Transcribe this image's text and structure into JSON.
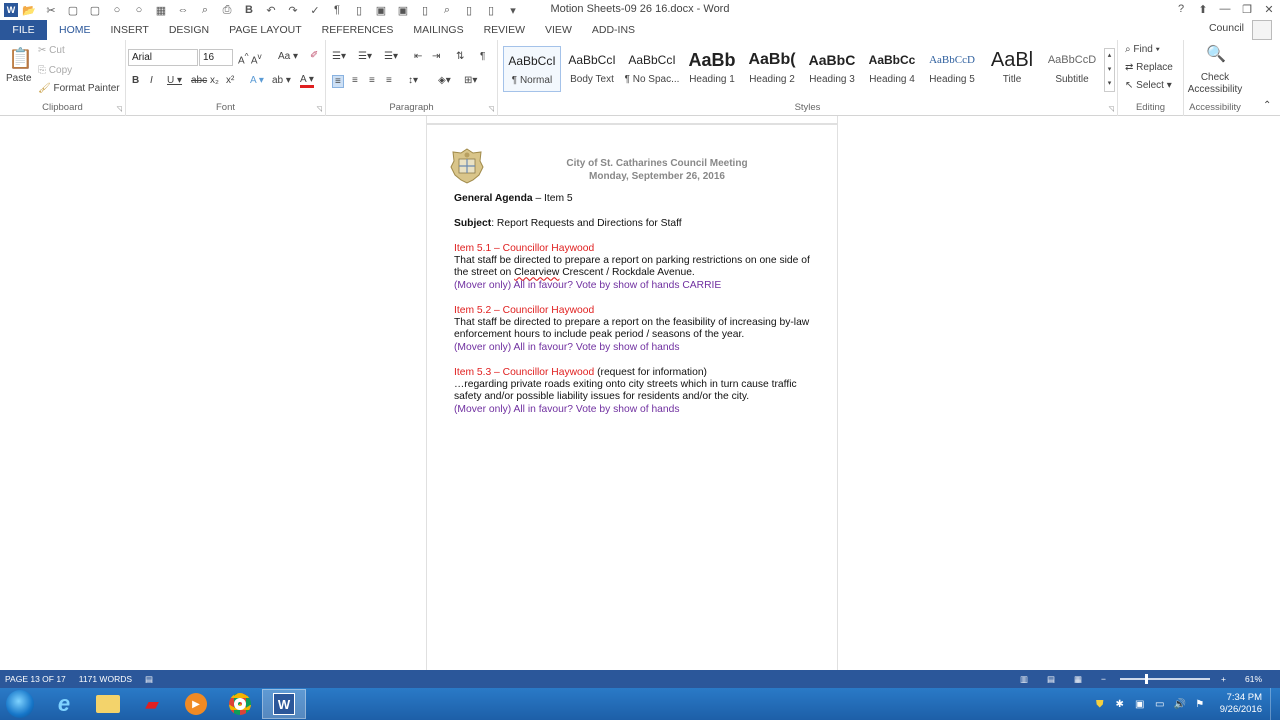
{
  "window": {
    "title": "Motion Sheets-09 26 16.docx - Word",
    "user": "Council"
  },
  "tabs": [
    "FILE",
    "HOME",
    "INSERT",
    "DESIGN",
    "PAGE LAYOUT",
    "REFERENCES",
    "MAILINGS",
    "REVIEW",
    "VIEW",
    "ADD-INS"
  ],
  "ribbon": {
    "clipboard": {
      "paste": "Paste",
      "cut": "Cut",
      "copy": "Copy",
      "format_painter": "Format Painter",
      "label": "Clipboard"
    },
    "font": {
      "name": "Arial",
      "size": "16",
      "label": "Font"
    },
    "paragraph": {
      "label": "Paragraph"
    },
    "styles": {
      "label": "Styles",
      "items": [
        {
          "preview": "AaBbCcI",
          "name": "¶ Normal"
        },
        {
          "preview": "AaBbCcI",
          "name": "Body Text"
        },
        {
          "preview": "AaBbCcI",
          "name": "¶ No Spac..."
        },
        {
          "preview": "AaBb",
          "name": "Heading 1"
        },
        {
          "preview": "AaBb(",
          "name": "Heading 2"
        },
        {
          "preview": "AaBbC",
          "name": "Heading 3"
        },
        {
          "preview": "AaBbCc",
          "name": "Heading 4"
        },
        {
          "preview": "AaBbCcD",
          "name": "Heading 5"
        },
        {
          "preview": "AaBl",
          "name": "Title"
        },
        {
          "preview": "AaBbCcD",
          "name": "Subtitle"
        }
      ]
    },
    "editing": {
      "find": "Find",
      "replace": "Replace",
      "select": "Select",
      "label": "Editing"
    },
    "accessibility": {
      "check": "Check Accessibility",
      "label": "Accessibility"
    }
  },
  "document": {
    "header_line1": "City of St. Catharines Council Meeting",
    "header_line2": "Monday, September 26, 2016",
    "agenda_bold": "General Agenda",
    "agenda_rest": " – Item 5",
    "subject_bold": "Subject",
    "subject_rest": ": Report Requests and Directions for Staff",
    "items": [
      {
        "heading": "Item 5.1 – Councillor Haywood",
        "heading_extra": "",
        "body_before": "That staff be directed to prepare a report on parking restrictions on one side of the street on ",
        "body_squig": "Clearview",
        "body_after": " Crescent / Rockdale Avenue.",
        "vote": "(Mover only)  All in favour?  Vote by show of hands CARRIE"
      },
      {
        "heading": "Item 5.2 – Councillor Haywood",
        "heading_extra": "",
        "body_before": "That staff be directed to prepare a report on the feasibility of increasing by-law enforcement hours to include peak period / seasons of the year.",
        "body_squig": "",
        "body_after": "",
        "vote": "(Mover only)  All in favour?  Vote by show of hands"
      },
      {
        "heading": "Item 5.3 – Councillor Haywood",
        "heading_extra": " (request for information)",
        "body_before": "…regarding private roads exiting onto city streets which in turn cause traffic safety and/or possible liability issues for residents and/or the city.",
        "body_squig": "",
        "body_after": "",
        "vote": "(Mover only)  All in favour?  Vote by show of hands"
      }
    ]
  },
  "status": {
    "page": "PAGE 13 OF 17",
    "words": "1171 WORDS",
    "zoom": "61%",
    "zoom_fraction": 0.61
  },
  "clock": {
    "time": "7:34 PM",
    "date": "9/26/2016"
  },
  "colors": {
    "accent": "#2b579a",
    "red": "#e02020",
    "purple": "#7030a0"
  }
}
